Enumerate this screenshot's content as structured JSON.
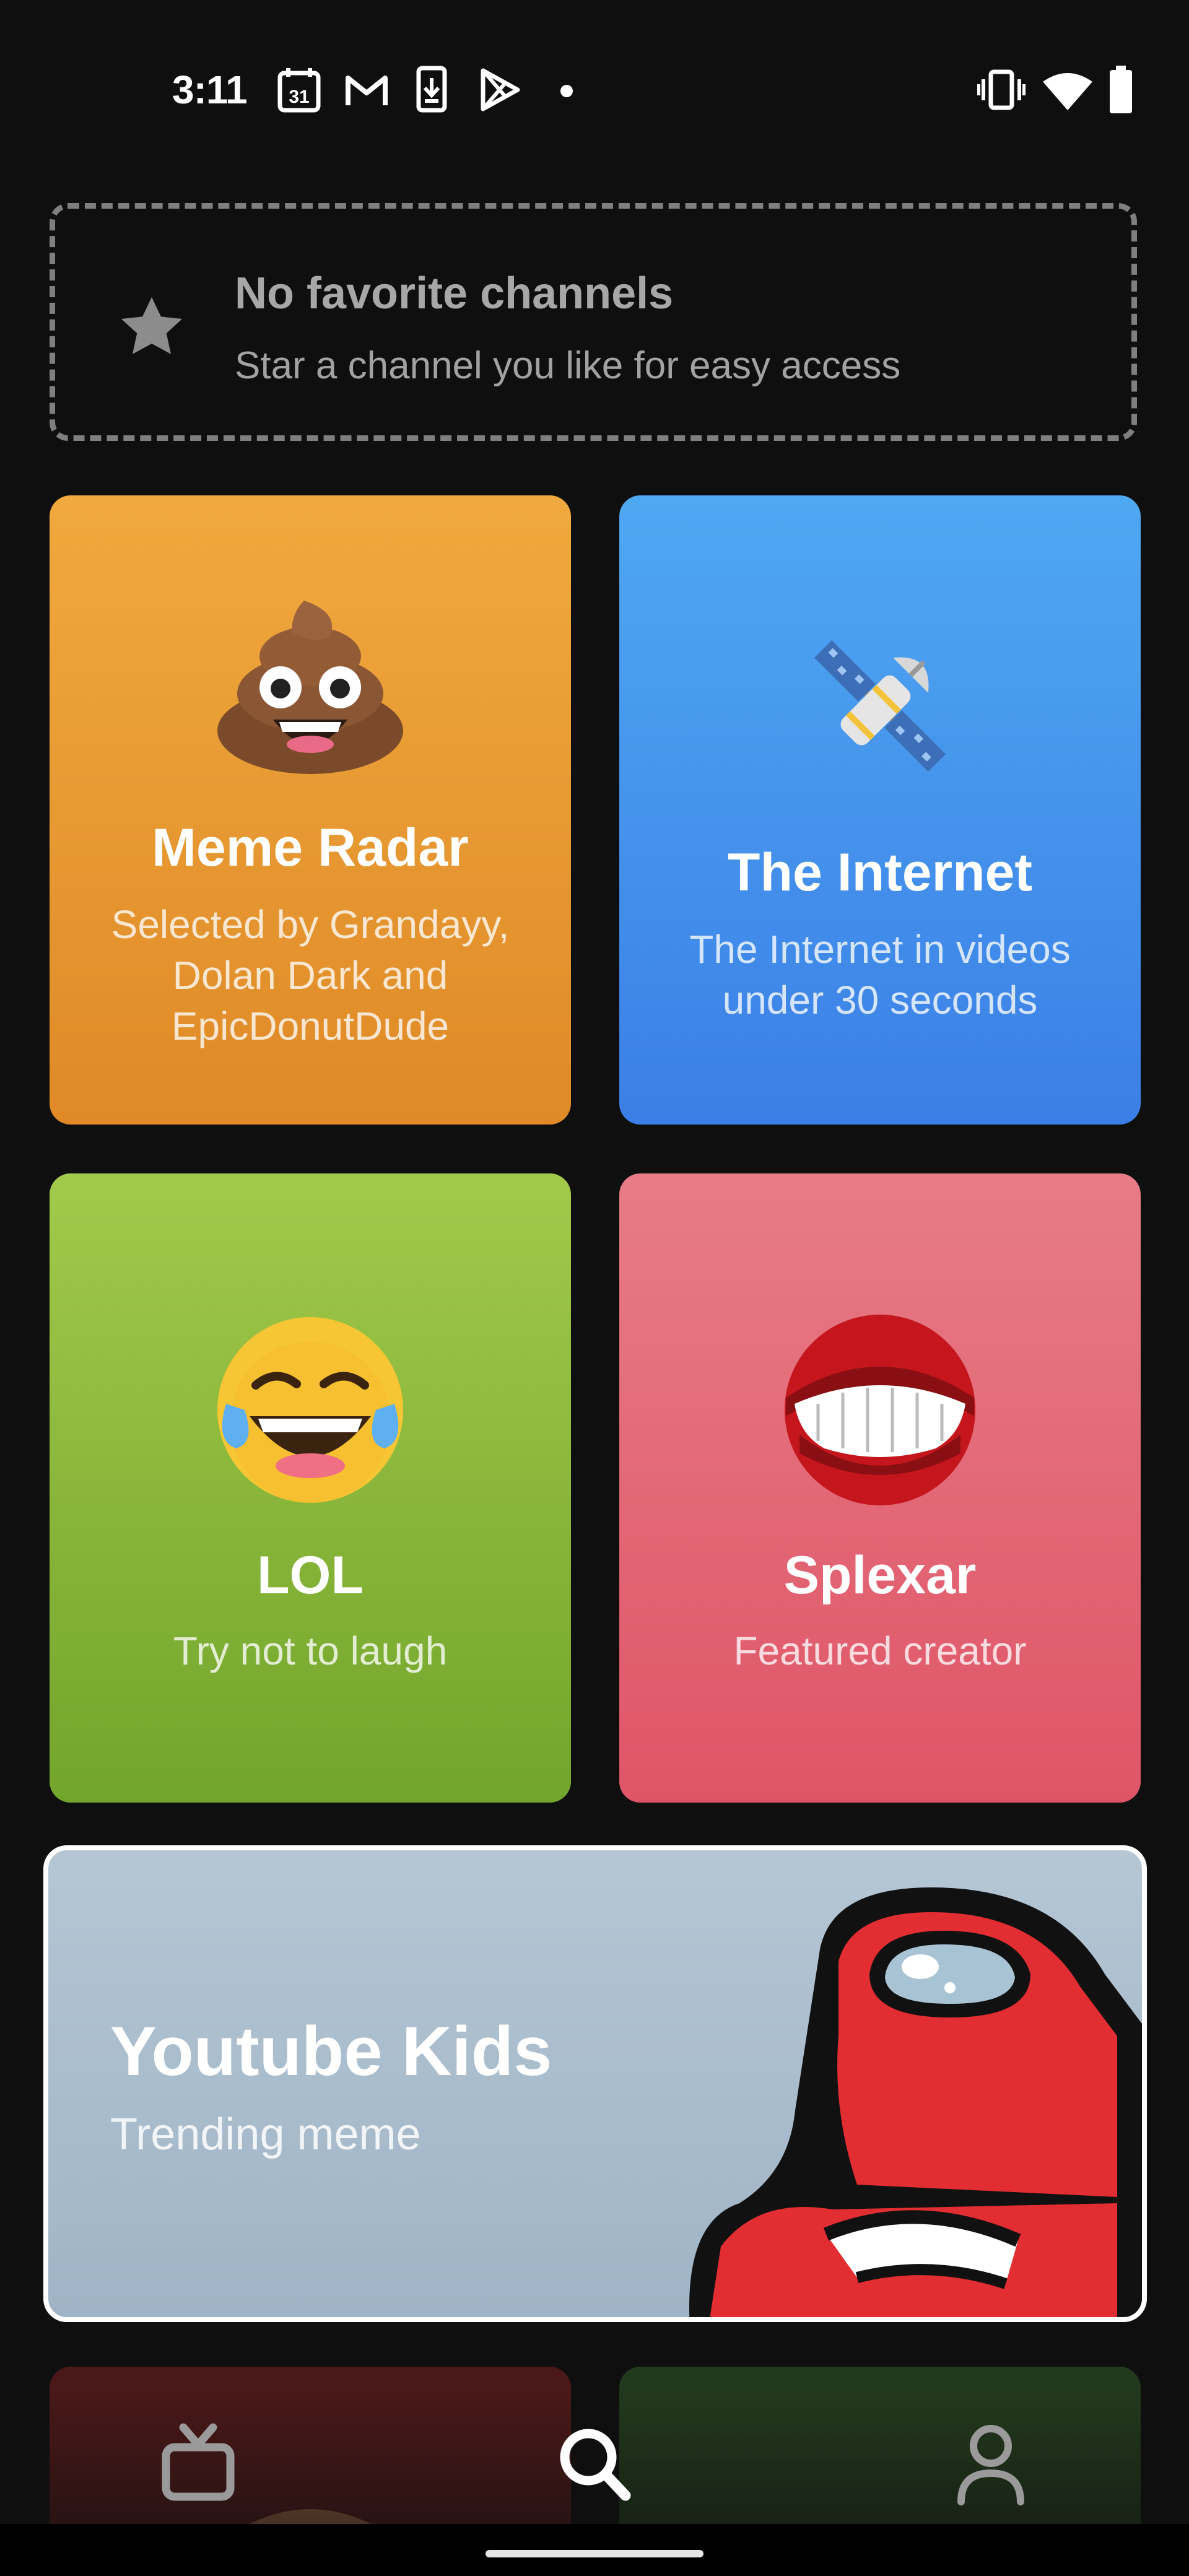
{
  "status_bar": {
    "time": "3:11",
    "left_icons": [
      "calendar-31-icon",
      "gmail-icon",
      "download-icon",
      "play-store-icon",
      "dot-icon"
    ],
    "right_icons": [
      "vibrate-icon",
      "wifi-icon",
      "battery-icon"
    ],
    "calendar_day": "31"
  },
  "favorites": {
    "title": "No favorite channels",
    "subtitle": "Star a channel you like for easy access",
    "icon": "star-icon"
  },
  "channels": [
    {
      "title": "Meme Radar",
      "subtitle": "Selected by Grandayy, Dolan Dark and EpicDonutDude",
      "emoji": "poop-emoji-icon",
      "color": "#e99a33"
    },
    {
      "title": "The Internet",
      "subtitle": "The Internet in videos under 30 seconds",
      "emoji": "satellite-emoji-icon",
      "color": "#4593ec"
    },
    {
      "title": "LOL",
      "subtitle": "Try not to laugh",
      "emoji": "tears-of-joy-emoji-icon",
      "color": "#8ab73a"
    },
    {
      "title": "Splexar",
      "subtitle": "Featured creator",
      "emoji": "mouth-avatar-icon",
      "color": "#e3687a"
    }
  ],
  "banner": {
    "title": "Youtube Kids",
    "subtitle": "Trending meme",
    "art": "among-us-crewmate-art"
  },
  "bottom_nav": {
    "items": [
      "tv-icon",
      "search-icon",
      "profile-icon"
    ],
    "active": "search-icon"
  }
}
